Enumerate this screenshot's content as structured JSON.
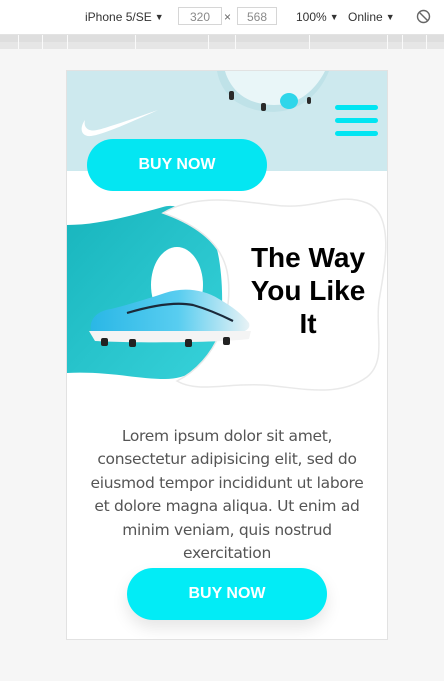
{
  "devtools": {
    "device": "iPhone 5/SE",
    "width": "320",
    "separator": "×",
    "height": "568",
    "zoom": "100%",
    "network": "Online",
    "caret": "▼",
    "rotate_icon": "rotate-icon"
  },
  "page": {
    "buy_top_label": "BUY NOW",
    "hero_title": "The Way You Like It",
    "body_text": "Lorem ipsum dolor sit amet, consectetur adipisicing elit, sed do eiusmod tempor incididunt ut labore et dolore magna aliqua. Ut enim ad minim veniam, quis nostrud exercitation",
    "buy_bottom_label": "BUY NOW",
    "icons": [
      "nike-swoosh-icon",
      "hamburger-menu-icon"
    ],
    "colors": {
      "accent": "#04e6f2",
      "header_band": "#cde9ee",
      "hero_teal": "#20c4cd",
      "text": "#555555"
    }
  }
}
